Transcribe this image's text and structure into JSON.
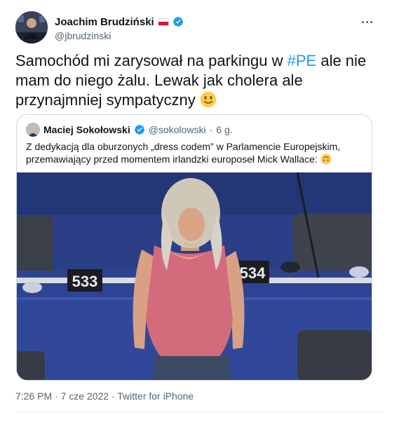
{
  "author": {
    "display_name": "Joachim Brudziński",
    "handle": "@jbrudzinski",
    "flag_icon": "poland-flag-icon",
    "verified_icon": "verified-badge-icon"
  },
  "tweet": {
    "text_before_hashtag": "Samochód mi zarysował na parkingu w ",
    "hashtag": "#PE",
    "text_after_hashtag": " ale nie mam do niego żalu. Lewak jak cholera ale przynajmniej sympatyczny ",
    "emoji": "slightly-smiling-face-icon"
  },
  "quoted_tweet": {
    "display_name": "Maciej Sokołowski",
    "handle": "@sokolowski",
    "separator": "·",
    "age": "6 g.",
    "text": "Z dedykacją dla oburzonych „dress codem” w Parlamencie Europejskim, przemawiający przed momentem irlandzki europoseł Mick Wallace: ",
    "emoji": "upside-down-face-icon",
    "media": {
      "seat_numbers": [
        "533",
        "534"
      ]
    }
  },
  "meta": {
    "timestamp": "7:26 PM · 7 cze 2022 · Twitter for iPhone"
  },
  "colors": {
    "accent": "#1d9bf0",
    "secondary_text": "#536471",
    "primary_text": "#0f1419",
    "border": "#cfd9de"
  }
}
